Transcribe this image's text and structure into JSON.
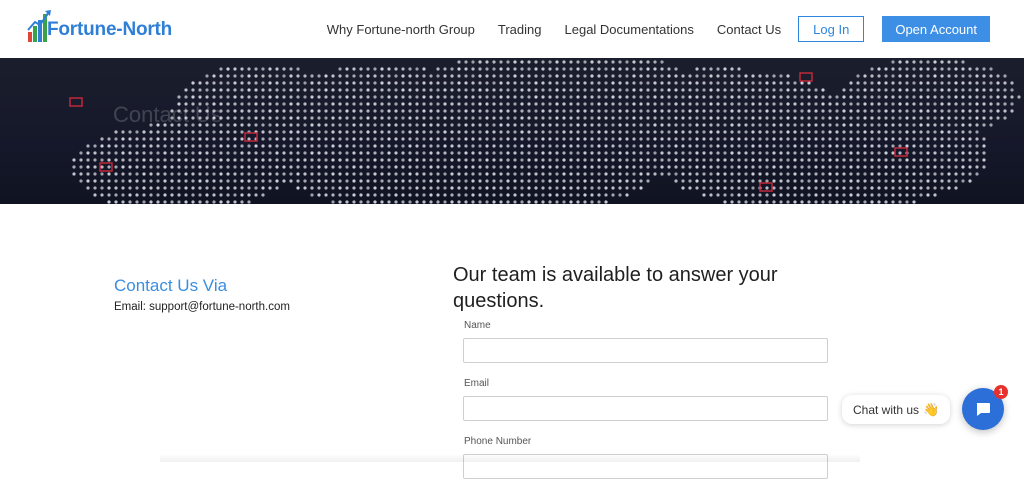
{
  "brand": {
    "name": "Fortune-North",
    "color": "#2f7fd6"
  },
  "nav": {
    "items": [
      {
        "label": "Why Fortune-north Group"
      },
      {
        "label": "Trading"
      },
      {
        "label": "Legal Documentations"
      },
      {
        "label": "Contact Us"
      }
    ],
    "login_label": "Log In",
    "open_account_label": "Open Account"
  },
  "hero": {
    "title": "Contact Us"
  },
  "contact": {
    "heading": "Contact Us Via",
    "email_text": "Email: support@fortune-north.com"
  },
  "form": {
    "heading": "Our team is available to answer your questions.",
    "fields": [
      {
        "label": "Name",
        "value": ""
      },
      {
        "label": "Email",
        "value": ""
      },
      {
        "label": "Phone Number",
        "value": ""
      }
    ]
  },
  "chat": {
    "bubble_text": "Chat with us",
    "wave_icon": "waving-hand-icon",
    "badge_count": "1",
    "accent": "#2c6fd8"
  }
}
